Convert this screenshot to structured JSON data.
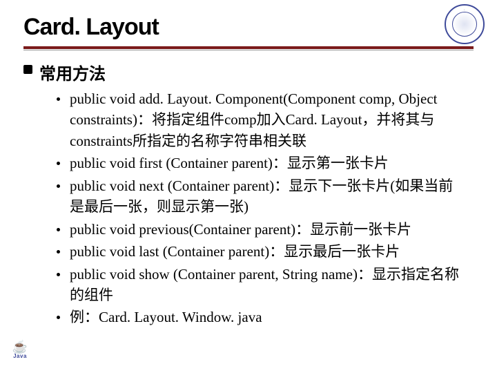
{
  "title": "Card. Layout",
  "section_label": "常用方法",
  "items": [
    "public void add. Layout. Component(Component comp, Object constraints)：将指定组件comp加入Card. Layout，并将其与constraints所指定的名称字符串相关联",
    "public void first (Container parent)：显示第一张卡片",
    "public void next (Container parent)：显示下一张卡片(如果当前是最后一张，则显示第一张)",
    "public void previous(Container parent)：显示前一张卡片",
    "public void last (Container parent)：显示最后一张卡片",
    "public void show (Container parent, String name)：显示指定名称的组件",
    "例：Card. Layout. Window. java"
  ],
  "java_label": "Java"
}
